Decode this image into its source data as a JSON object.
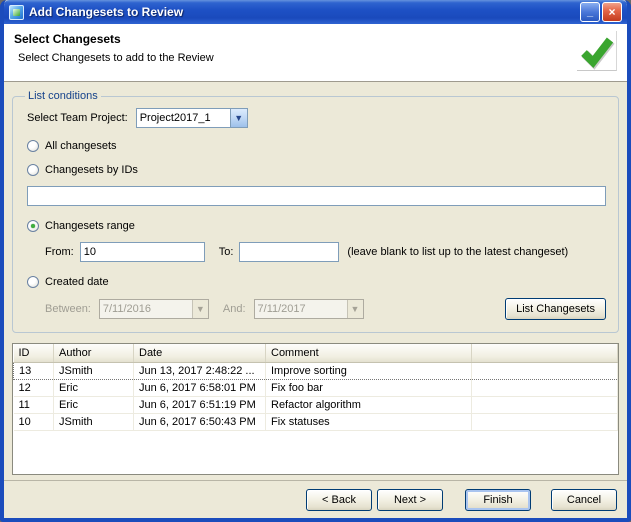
{
  "window": {
    "title": "Add Changesets to Review"
  },
  "titlebar_icons": {
    "minimize_glyph": "_",
    "close_glyph": "×",
    "dropdown_glyph": "▼"
  },
  "header": {
    "title": "Select Changesets",
    "subtitle": "Select Changesets to add to the Review"
  },
  "conditions": {
    "group_label": "List conditions",
    "team_project_label": "Select Team Project:",
    "team_project_value": "Project2017_1",
    "radio_all_label": "All changesets",
    "radio_ids_label": "Changesets by IDs",
    "ids_value": "",
    "radio_range_label": "Changesets range",
    "from_label": "From:",
    "from_value": "10",
    "to_label": "To:",
    "to_value": "",
    "range_hint": "(leave blank to list up to the latest changeset)",
    "radio_created_label": "Created date",
    "between_label": "Between:",
    "between_value": "7/11/2016",
    "and_label": "And:",
    "and_value": "7/11/2017",
    "list_changesets_button": "List Changesets"
  },
  "table": {
    "columns": [
      "ID",
      "Author",
      "Date",
      "Comment",
      ""
    ],
    "rows": [
      {
        "id": "13",
        "author": "JSmith",
        "date": "Jun 13, 2017 2:48:22 ...",
        "comment": "Improve sorting"
      },
      {
        "id": "12",
        "author": "Eric",
        "date": "Jun 6, 2017 6:58:01 PM",
        "comment": "Fix foo bar"
      },
      {
        "id": "11",
        "author": "Eric",
        "date": "Jun 6, 2017 6:51:19 PM",
        "comment": "Refactor algorithm"
      },
      {
        "id": "10",
        "author": "JSmith",
        "date": "Jun 6, 2017 6:50:43 PM",
        "comment": "Fix statuses"
      }
    ]
  },
  "footer": {
    "back_label": "< Back",
    "next_label": "Next >",
    "finish_label": "Finish",
    "cancel_label": "Cancel"
  },
  "colors": {
    "titlebar_blue": "#1b4cbc",
    "radio_selected_green": "#3fae3f",
    "check_green": "#3aa52f",
    "dialog_background": "#ece9d8"
  }
}
